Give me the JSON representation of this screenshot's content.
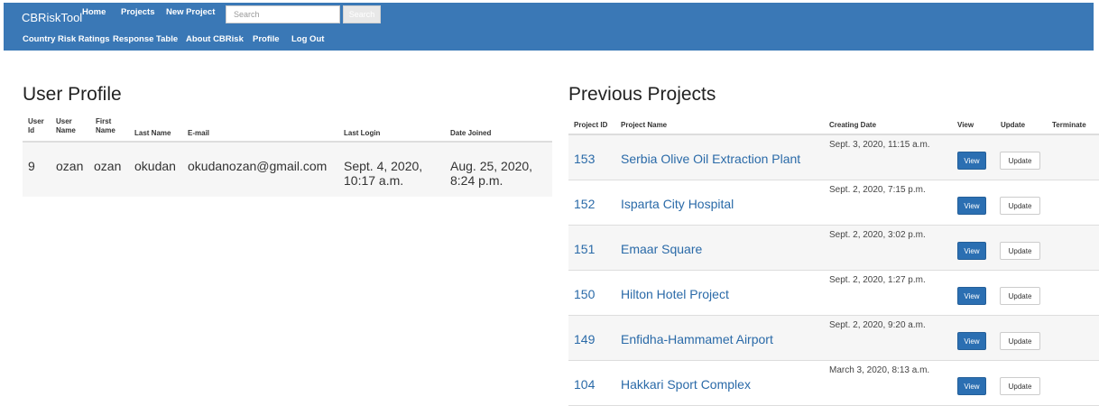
{
  "nav": {
    "brand": "CBRiskTool",
    "row1": [
      "Home",
      "Projects",
      "New Project"
    ],
    "row2": [
      "Country Risk Ratings",
      "Response Table",
      "About CBRisk",
      "Profile",
      "Log Out"
    ],
    "search": {
      "placeholder": "Search",
      "button_label": "Search"
    }
  },
  "colors": {
    "navbar": "#3a78b6",
    "link": "#2a6aa8",
    "view_button": "#2b6fb2"
  },
  "profile": {
    "title": "User Profile",
    "headers": {
      "user_id": [
        "User",
        "Id"
      ],
      "user_name": [
        "User",
        "Name"
      ],
      "first_name": [
        "First",
        "Name"
      ],
      "last_name": "Last Name",
      "email": "E-mail",
      "last_login": "Last Login",
      "date_joined": "Date Joined"
    },
    "row": {
      "user_id": "9",
      "user_name": "ozan",
      "first_name": "ozan",
      "last_name": "okudan",
      "email": "okudanozan@gmail.com",
      "last_login": [
        "Sept. 4, 2020,",
        "10:17 a.m."
      ],
      "date_joined": [
        "Aug. 25, 2020,",
        "8:24 p.m."
      ]
    }
  },
  "projects": {
    "title": "Previous Projects",
    "headers": {
      "id": "Project ID",
      "name": "Project Name",
      "date": "Creating Date",
      "view": "View",
      "update": "Update",
      "terminate": "Terminate"
    },
    "view_label": "View",
    "update_label": "Update",
    "rows": [
      {
        "id": "153",
        "name": "Serbia Olive Oil Extraction Plant",
        "date": "Sept. 3, 2020, 11:15 a.m."
      },
      {
        "id": "152",
        "name": "Isparta City Hospital",
        "date": "Sept. 2, 2020, 7:15 p.m."
      },
      {
        "id": "151",
        "name": "Emaar Square",
        "date": "Sept. 2, 2020, 3:02 p.m."
      },
      {
        "id": "150",
        "name": "Hilton Hotel Project",
        "date": "Sept. 2, 2020, 1:27 p.m."
      },
      {
        "id": "149",
        "name": "Enfidha-Hammamet Airport",
        "date": "Sept. 2, 2020, 9:20 a.m."
      },
      {
        "id": "104",
        "name": "Hakkari Sport Complex",
        "date": "March 3, 2020, 8:13 a.m."
      }
    ]
  }
}
